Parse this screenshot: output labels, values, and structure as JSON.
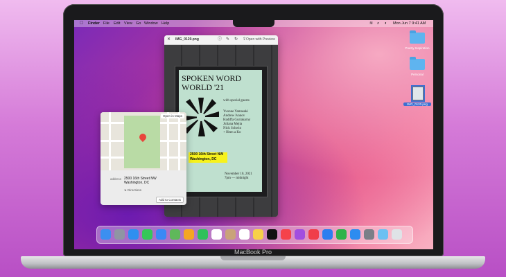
{
  "device": {
    "brand_label": "MacBook Pro"
  },
  "menubar": {
    "app": "Finder",
    "items": [
      "File",
      "Edit",
      "View",
      "Go",
      "Window",
      "Help"
    ],
    "clock": "Mon Jun 7  9:41 AM"
  },
  "desktop": {
    "items": [
      {
        "label": "Poetry Inspiration",
        "icon": "folder-icon"
      },
      {
        "label": "Personal",
        "icon": "folder-icon"
      },
      {
        "label": "IMG_0120.png",
        "icon": "image-file-icon"
      }
    ]
  },
  "quicklook": {
    "filename": "IMG_0120.png",
    "open_with": "Open with Preview",
    "poster_title": "SPOKEN WORD WORLD '21",
    "poster_guests_heading": "with special guests",
    "poster_guests": [
      "Yvonne Yamasaki",
      "Andrew Ivanov",
      "Hadiffa Guriakarny",
      "Juliana Mejia",
      "Nick Schwin",
      "+ Heen a Ko"
    ],
    "poster_date": "November 10, 2021",
    "poster_time": "7pm — midnight",
    "detected_text_line1": "2500 16th Street NW",
    "detected_text_line2": "Washington, DC"
  },
  "map_popover": {
    "open_in_maps": "Open in Maps",
    "address_label": "address",
    "address_line1": "2500 16th Street NW",
    "address_line2": "Washington, DC",
    "directions": "Directions",
    "add_to_contacts": "Add to Contacts"
  },
  "dock": {
    "apps": [
      {
        "name": "Finder",
        "color": "#3b8ff0"
      },
      {
        "name": "Launchpad",
        "color": "#8f95a3"
      },
      {
        "name": "Safari",
        "color": "#2f8ff0"
      },
      {
        "name": "Messages",
        "color": "#34c759"
      },
      {
        "name": "Mail",
        "color": "#3a89f5"
      },
      {
        "name": "Maps",
        "color": "#5fb85a"
      },
      {
        "name": "Photos",
        "color": "#f5a623"
      },
      {
        "name": "FaceTime",
        "color": "#30c15a"
      },
      {
        "name": "Calendar",
        "color": "#ffffff"
      },
      {
        "name": "Contacts",
        "color": "#c9a37a"
      },
      {
        "name": "Reminders",
        "color": "#ffffff"
      },
      {
        "name": "Notes",
        "color": "#f7d04a"
      },
      {
        "name": "TV",
        "color": "#111111"
      },
      {
        "name": "Music",
        "color": "#f5424b"
      },
      {
        "name": "Podcasts",
        "color": "#a24ee0"
      },
      {
        "name": "News",
        "color": "#f03e4a"
      },
      {
        "name": "Keynote",
        "color": "#2c7ef0"
      },
      {
        "name": "Numbers",
        "color": "#2fb34a"
      },
      {
        "name": "App Store",
        "color": "#2d8cf0"
      },
      {
        "name": "System Preferences",
        "color": "#7b7f87"
      },
      {
        "name": "Downloads",
        "color": "#6cc0f2"
      },
      {
        "name": "Trash",
        "color": "#dfe3e7"
      }
    ]
  }
}
